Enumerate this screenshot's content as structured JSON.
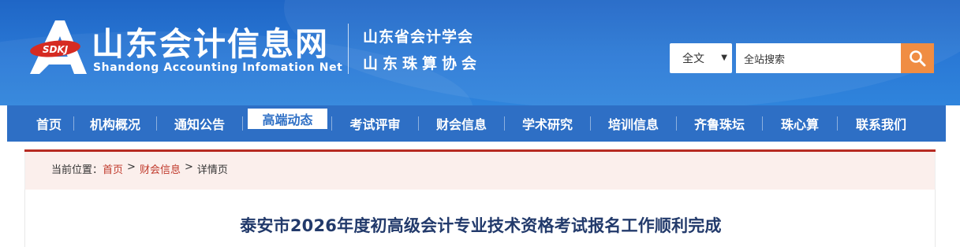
{
  "site": {
    "logo_badge": "SDKJ",
    "name_cn": "山东会计信息网",
    "name_en": "Shandong Accounting Infomation Net",
    "assoc_1": "山东省会计学会",
    "assoc_2": "山东珠算协会"
  },
  "search": {
    "scope_selected": "全文",
    "placeholder": "全站搜索",
    "button_icon": "search-icon"
  },
  "nav": {
    "items": [
      {
        "label": "首页"
      },
      {
        "label": "机构概况"
      },
      {
        "label": "通知公告"
      },
      {
        "label": "高端动态"
      },
      {
        "label": "考试评审"
      },
      {
        "label": "财会信息"
      },
      {
        "label": "学术研究"
      },
      {
        "label": "培训信息"
      },
      {
        "label": "齐鲁珠坛"
      },
      {
        "label": "珠心算"
      },
      {
        "label": "联系我们"
      }
    ]
  },
  "breadcrumb": {
    "prefix": "当前位置：",
    "home": "首页",
    "section": "财会信息",
    "current": "详情页",
    "separator": ">"
  },
  "article": {
    "title": "泰安市2026年度初高级会计专业技术资格考试报名工作顺利完成"
  },
  "colors": {
    "header_blue": "#2a79d6",
    "nav_blue": "#2e6fc5",
    "search_orange": "#f08d43",
    "accent_red": "#b72a22",
    "title_navy": "#223a6b"
  }
}
